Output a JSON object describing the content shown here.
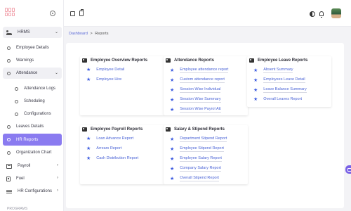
{
  "sidebar": {
    "items": [
      {
        "label": "HRMS",
        "chevron": "⌄"
      },
      {
        "label": "Employee Details"
      },
      {
        "label": "Warnings"
      },
      {
        "label": "Attendance",
        "chevron": "⌄"
      },
      {
        "label": "Attendance Logs"
      },
      {
        "label": "Scheduling"
      },
      {
        "label": "Configurations"
      },
      {
        "label": "Leaves Details"
      },
      {
        "label": "HR Reports"
      },
      {
        "label": "Organization Chart"
      },
      {
        "label": "Payroll",
        "chevron": "›"
      },
      {
        "label": "Fuel",
        "chevron": "›"
      },
      {
        "label": "HR Configurations",
        "chevron": "›"
      },
      {
        "label": "PROGRAMS"
      }
    ]
  },
  "breadcrumb": {
    "home": "Dashboard",
    "separator": ">",
    "current": "Reports"
  },
  "cards": {
    "employee_overview": {
      "title": "Employee Overview Reports",
      "links": [
        "Employee Detail",
        "Employee Hire"
      ]
    },
    "attendance": {
      "title": "Attendance Reports",
      "links": [
        "Employee attendance report",
        "Custom attendance report",
        "Session Wise Individual",
        "Session Wise Summary",
        "Session Wise Payrol Att"
      ]
    },
    "employee_leave": {
      "title": "Employee Leave Reports",
      "links": [
        "Absent Summary",
        "Employees Leave Detail",
        "Leave Balance Summary",
        "Overall Leaves Report"
      ]
    },
    "employee_payroll": {
      "title": "Employee Payroll Reports",
      "links": [
        "Loan Advance Report",
        "Arrears Report",
        "Cash Distribution Report"
      ]
    },
    "salary_stipend": {
      "title": "Salary & Stipend Reports",
      "links": [
        "Department Stipend Report",
        "Employee Stipend Report",
        "Employee Salary Report",
        "Company Salary Report",
        "Overall Stipend Report"
      ]
    }
  },
  "colors": {
    "accent": "#8a7bf0",
    "link": "#4a63d6",
    "star": "#3c5be0"
  }
}
